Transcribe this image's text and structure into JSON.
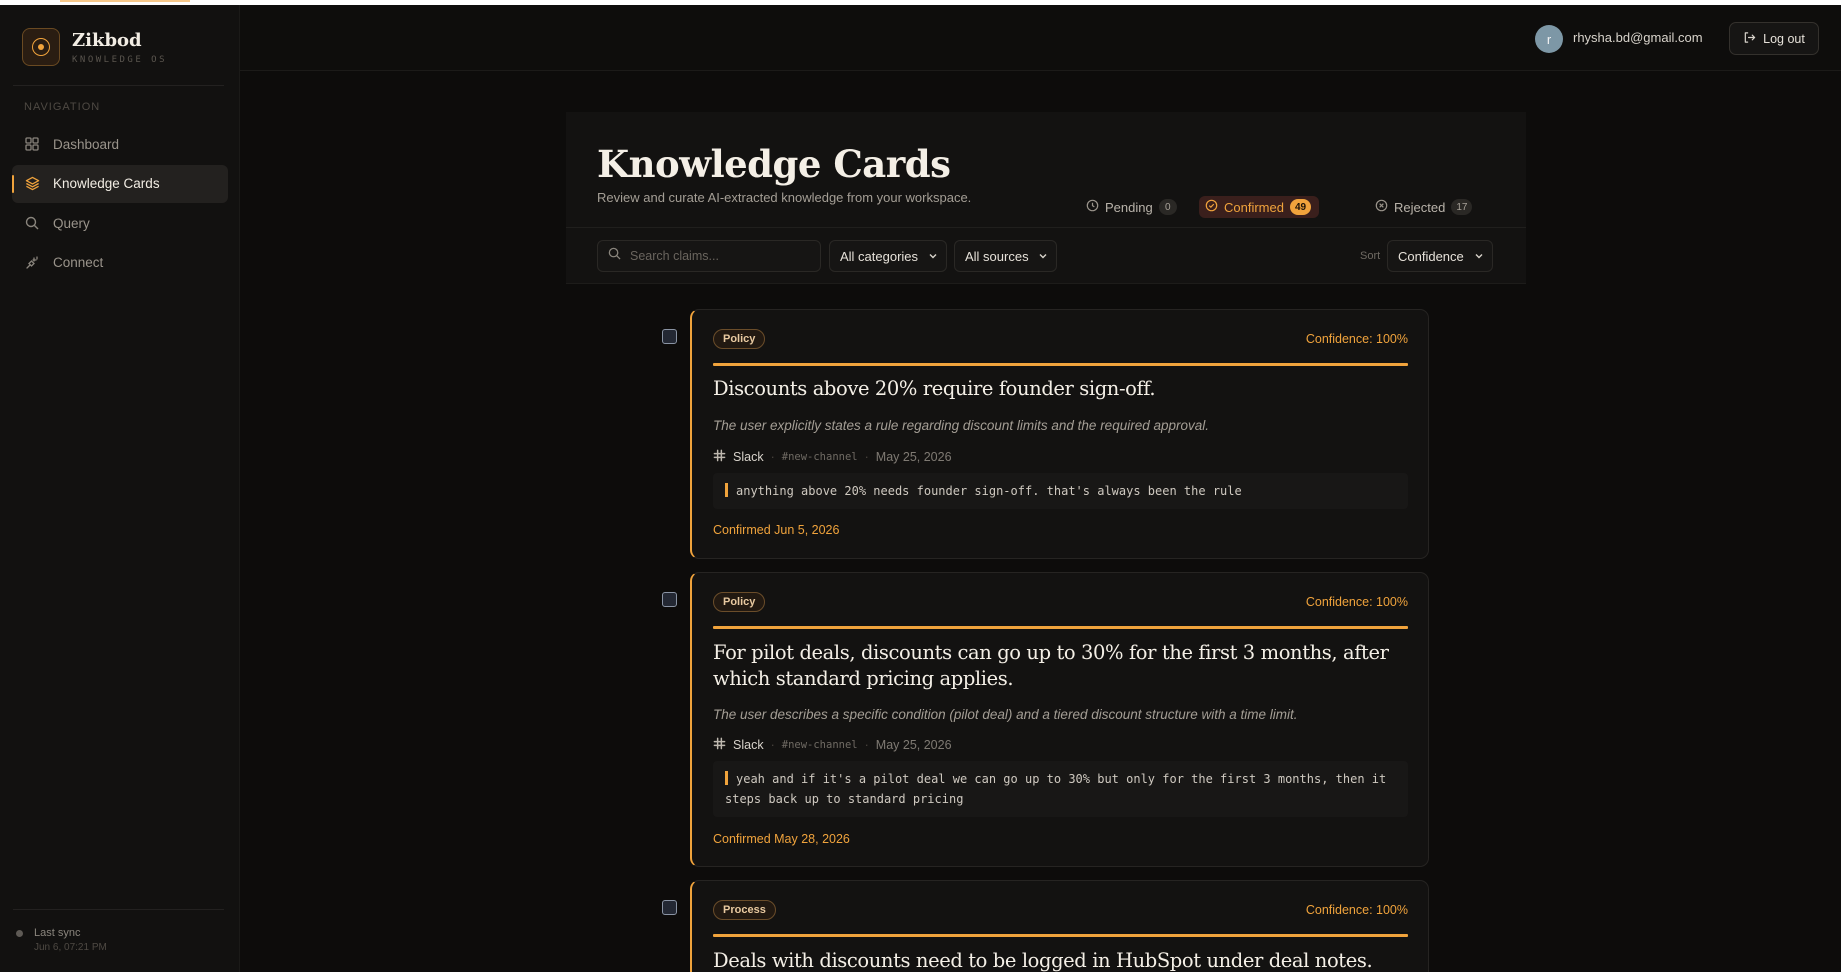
{
  "brand": {
    "name": "Zikbod",
    "subtitle": "KNOWLEDGE OS"
  },
  "nav": {
    "title": "NAVIGATION",
    "items": [
      {
        "label": "Dashboard",
        "icon": "grid-icon"
      },
      {
        "label": "Knowledge Cards",
        "icon": "layers-icon",
        "active": true
      },
      {
        "label": "Query",
        "icon": "search-icon"
      },
      {
        "label": "Connect",
        "icon": "plug-icon"
      }
    ]
  },
  "sync": {
    "label": "Last sync",
    "time": "Jun 6, 07:21 PM"
  },
  "user": {
    "initial": "r",
    "email": "rhysha.bd@gmail.com",
    "logout_label": "Log out"
  },
  "page": {
    "title": "Knowledge Cards",
    "subtitle": "Review and curate AI-extracted knowledge from your workspace."
  },
  "tabs": [
    {
      "label": "Pending",
      "count": "0",
      "icon": "clock-icon"
    },
    {
      "label": "Confirmed",
      "count": "49",
      "icon": "check-circle-icon",
      "active": true
    },
    {
      "label": "Rejected",
      "count": "17",
      "icon": "x-circle-icon"
    }
  ],
  "filters": {
    "search_placeholder": "Search claims...",
    "category": "All categories",
    "source": "All sources",
    "sort_label": "Sort",
    "sort_value": "Confidence"
  },
  "cards": [
    {
      "tag": "Policy",
      "confidence": "Confidence: 100%",
      "claim": "Discounts above 20% require founder sign-off.",
      "reason": "The user explicitly states a rule regarding discount limits and the required approval.",
      "source": "Slack",
      "channel": "#new-channel",
      "date": "May 25, 2026",
      "quote": "anything above 20% needs founder sign-off. that's always been the rule",
      "confirmed": "Confirmed Jun 5, 2026"
    },
    {
      "tag": "Policy",
      "confidence": "Confidence: 100%",
      "claim": "For pilot deals, discounts can go up to 30% for the first 3 months, after which standard pricing applies.",
      "reason": "The user describes a specific condition (pilot deal) and a tiered discount structure with a time limit.",
      "source": "Slack",
      "channel": "#new-channel",
      "date": "May 25, 2026",
      "quote": "yeah and if it's a pilot deal we can go up to 30% but only for the first 3 months, then it steps back up to standard pricing",
      "confirmed": "Confirmed May 28, 2026"
    },
    {
      "tag": "Process",
      "confidence": "Confidence: 100%",
      "claim": "Deals with discounts need to be logged in HubSpot under deal notes."
    }
  ],
  "colors": {
    "accent": "#f0a33c",
    "background": "#0d0c0b",
    "surface": "#131211"
  }
}
